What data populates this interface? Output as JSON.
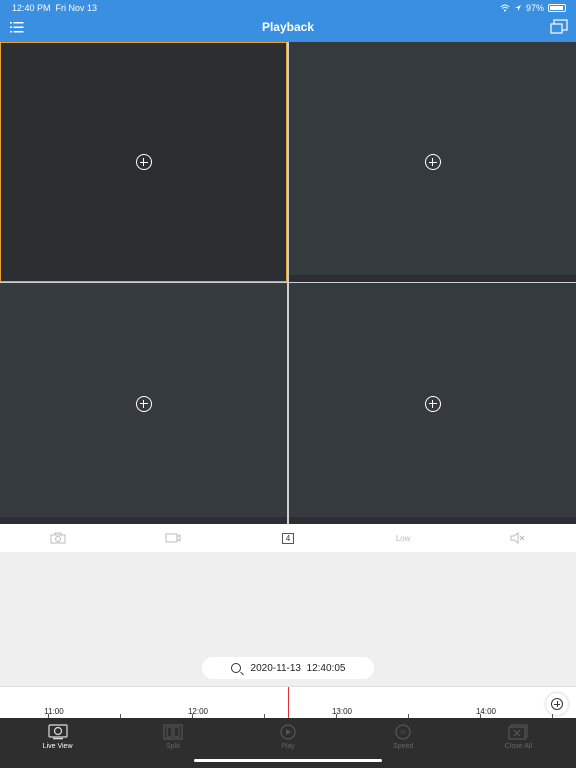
{
  "status": {
    "time": "12:40 PM",
    "date": "Fri Nov 13",
    "battery": "97%"
  },
  "header": {
    "title": "Playback"
  },
  "toolbar": {
    "split_count": "4",
    "quality": "Low"
  },
  "search": {
    "datetime": "2020-11-13  12:40:05"
  },
  "timeline": {
    "labels": [
      "11:00",
      "12:00",
      "13:00",
      "14:00"
    ]
  },
  "tabs": [
    {
      "label": "Live View",
      "active": true
    },
    {
      "label": "Split",
      "active": false
    },
    {
      "label": "Play",
      "active": false
    },
    {
      "label": "Speed",
      "active": false
    },
    {
      "label": "Close All",
      "active": false
    }
  ],
  "colors": {
    "header": "#3a8fe0",
    "selected_border": "#e6a238",
    "playhead": "#e23030",
    "tabbar": "#2e2e2e"
  }
}
